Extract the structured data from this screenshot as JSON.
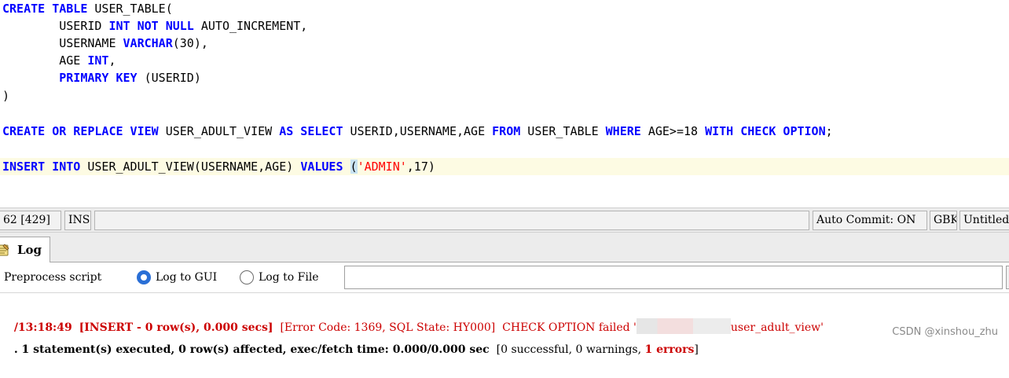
{
  "editor": {
    "lines": [
      [
        {
          "t": "CREATE TABLE",
          "c": "kw"
        },
        {
          "t": " USER_TABLE(",
          "c": ""
        }
      ],
      [
        {
          "t": "        USERID ",
          "c": ""
        },
        {
          "t": "INT NOT NULL",
          "c": "kw"
        },
        {
          "t": " AUTO_INCREMENT,",
          "c": ""
        }
      ],
      [
        {
          "t": "        USERNAME ",
          "c": ""
        },
        {
          "t": "VARCHAR",
          "c": "kw"
        },
        {
          "t": "(30),",
          "c": ""
        }
      ],
      [
        {
          "t": "        AGE ",
          "c": ""
        },
        {
          "t": "INT",
          "c": "kw"
        },
        {
          "t": ",",
          "c": ""
        }
      ],
      [
        {
          "t": "        ",
          "c": ""
        },
        {
          "t": "PRIMARY KEY",
          "c": "kw"
        },
        {
          "t": " (USERID)",
          "c": ""
        }
      ],
      [
        {
          "t": ")",
          "c": ""
        }
      ],
      [],
      [
        {
          "t": "CREATE OR REPLACE VIEW",
          "c": "kw"
        },
        {
          "t": " USER_ADULT_VIEW ",
          "c": ""
        },
        {
          "t": "AS SELECT",
          "c": "kw"
        },
        {
          "t": " USERID,USERNAME,AGE ",
          "c": ""
        },
        {
          "t": "FROM",
          "c": "kw"
        },
        {
          "t": " USER_TABLE ",
          "c": ""
        },
        {
          "t": "WHERE",
          "c": "kw"
        },
        {
          "t": " AGE>=18 ",
          "c": ""
        },
        {
          "t": "WITH CHECK OPTION",
          "c": "kw"
        },
        {
          "t": ";",
          "c": ""
        }
      ],
      [],
      [
        {
          "t": "INSERT INTO",
          "c": "kw"
        },
        {
          "t": " USER_ADULT_VIEW(USERNAME,AGE) ",
          "c": ""
        },
        {
          "t": "VALUES",
          "c": "kw"
        },
        {
          "t": " ",
          "c": ""
        },
        {
          "t": "(",
          "c": "bracket"
        },
        {
          "t": "'ADMIN'",
          "c": "str"
        },
        {
          "t": ",17)",
          "c": ""
        }
      ]
    ]
  },
  "statusbar": {
    "position": "62 [429]",
    "mode": "INS",
    "autocommit": "Auto Commit: ON",
    "encoding": "GBK",
    "tab_title": "Untitled"
  },
  "log_panel": {
    "tab_label": "Log",
    "preprocess_label": "Preprocess script",
    "option_gui": "Log to GUI",
    "option_file": "Log to File",
    "selected_option": "gui",
    "file_path_value": "",
    "entry1": {
      "time": "/13:18:49",
      "query": "[INSERT - 0 row(s), 0.000 secs]",
      "error": "[Error Code: 1369, SQL State: HY000]  CHECK OPTION failed '",
      "view": "user_adult_view'"
    },
    "entry2": {
      "summary": ". 1 statement(s) executed, 0 row(s) affected, exec/fetch time: 0.000/0.000 sec",
      "counts": "[0 successful, 0 warnings, ",
      "errors": "1 errors",
      "close": "]"
    }
  },
  "watermark": "CSDN @xinshou_zhu",
  "colors": {
    "keyword": "#0000ff",
    "string": "#ff0000",
    "error": "#cc0000",
    "current_line": "#fdfbe3",
    "radio_checked": "#2a6fd6"
  }
}
